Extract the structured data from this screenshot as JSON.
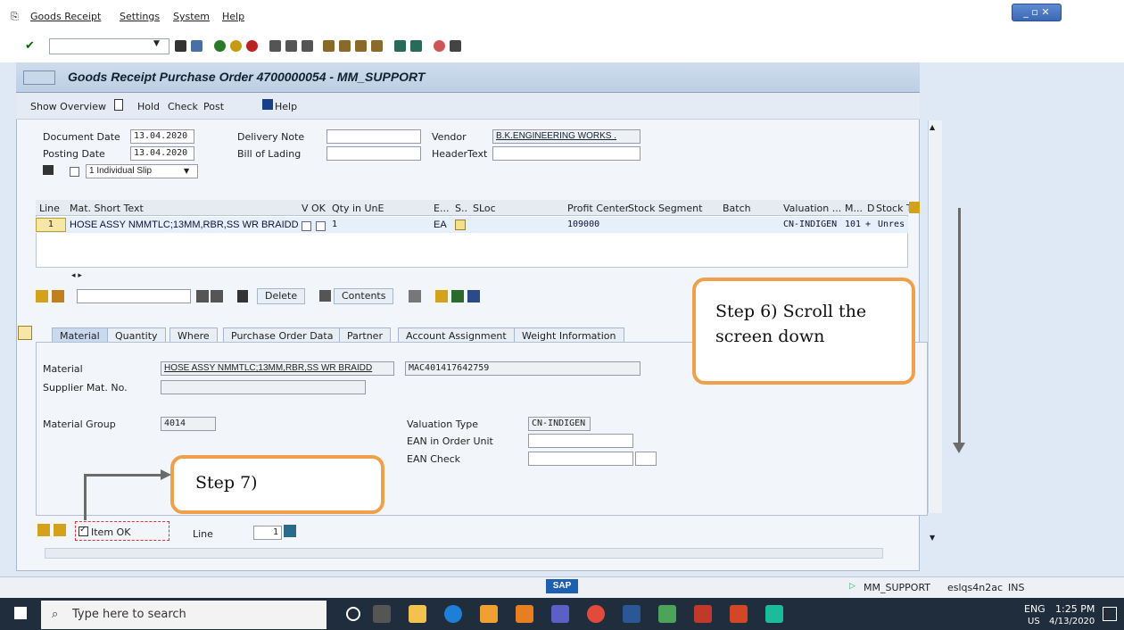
{
  "menu": {
    "items": [
      "Goods Receipt",
      "Settings",
      "System",
      "Help"
    ]
  },
  "window": {
    "title": "Goods Receipt Purchase Order 4700000054 - MM_SUPPORT"
  },
  "appbar": {
    "show_overview": "Show Overview",
    "hold": "Hold",
    "check": "Check",
    "post": "Post",
    "help": "Help"
  },
  "header": {
    "document_date_label": "Document Date",
    "document_date": "13.04.2020",
    "posting_date_label": "Posting Date",
    "posting_date": "13.04.2020",
    "delivery_note_label": "Delivery Note",
    "bill_of_lading_label": "Bill of Lading",
    "vendor_label": "Vendor",
    "vendor": "B.K.ENGINEERING WORKS .",
    "header_text_label": "HeaderText",
    "slip_option": "1 Individual Slip"
  },
  "grid": {
    "columns": [
      "Line",
      "Mat. Short Text",
      "V",
      "OK",
      "Qty in UnE",
      "E...",
      "S..",
      "SLoc",
      "Profit Center",
      "Stock Segment",
      "Batch",
      "Valuation ...",
      "M...",
      "D",
      "Stock T"
    ],
    "rows": [
      {
        "line": "1",
        "text": "HOSE ASSY NMMTLC;13MM,RBR,SS WR BRAIDD",
        "qty": "1",
        "unit": "EA",
        "profit_center": "109000",
        "valuation": "CN-INDIGEN",
        "mvt": "101",
        "d": "+",
        "stock": "Unres"
      }
    ]
  },
  "grid_toolbar": {
    "delete": "Delete",
    "contents": "Contents"
  },
  "tabs": [
    "Material",
    "Quantity",
    "Where",
    "Purchase Order Data",
    "Partner",
    "Account Assignment",
    "Weight Information"
  ],
  "material_tab": {
    "material_label": "Material",
    "material": "HOSE ASSY NMMTLC;13MM,RBR,SS WR BRAIDD",
    "material_code": "MAC401417642759",
    "supplier_mat_label": "Supplier Mat. No.",
    "material_group_label": "Material Group",
    "material_group": "4014",
    "valuation_type_label": "Valuation Type",
    "valuation_type": "CN-INDIGEN",
    "ean_order_unit_label": "EAN in Order Unit",
    "ean_check_label": "EAN Check"
  },
  "footer": {
    "item_ok": "Item OK",
    "line_label": "Line",
    "line_value": "1"
  },
  "callouts": {
    "step6": "Step 6) Scroll the screen down",
    "step7": "Step 7)"
  },
  "statusbar": {
    "sap": "SAP",
    "user": "MM_SUPPORT",
    "server": "eslqs4n2ac",
    "mode": "INS"
  },
  "taskbar": {
    "search_placeholder": "Type here to search",
    "lang": "ENG",
    "region": "US",
    "time": "1:25 PM",
    "date": "4/13/2020"
  }
}
